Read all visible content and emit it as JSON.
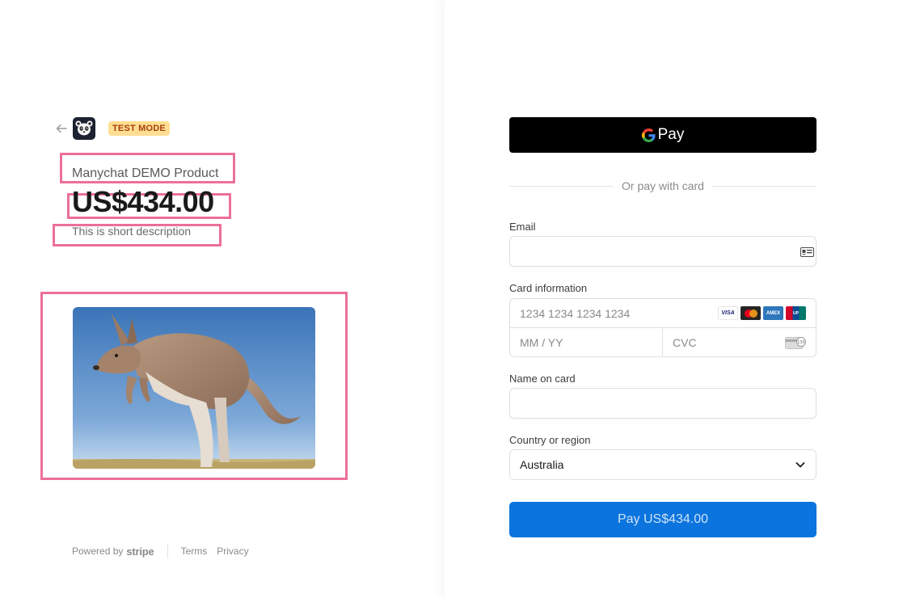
{
  "header": {
    "test_mode_badge": "TEST MODE",
    "icons": {
      "back": "arrow-left-icon",
      "logo": "panda-logo-icon"
    }
  },
  "product": {
    "name": "Manychat DEMO Product",
    "price": "US$434.00",
    "description": "This is short description",
    "image_subject": "kangaroo-photo"
  },
  "footer": {
    "powered_by": "Powered by",
    "brand": "stripe",
    "terms": "Terms",
    "privacy": "Privacy"
  },
  "payment": {
    "gpay_label": "Pay",
    "divider_text": "Or pay with card",
    "email": {
      "label": "Email",
      "value": "",
      "placeholder": ""
    },
    "card": {
      "label": "Card information",
      "number_placeholder": "1234 1234 1234 1234",
      "expiry_placeholder": "MM / YY",
      "cvc_placeholder": "CVC",
      "brands": [
        "VISA",
        "mastercard",
        "amex",
        "unionpay"
      ]
    },
    "name_on_card": {
      "label": "Name on card",
      "value": ""
    },
    "country": {
      "label": "Country or region",
      "selected": "Australia"
    },
    "submit_label": "Pay US$434.00"
  },
  "colors": {
    "pay_button": "#0b74de",
    "badge_bg": "#ffde92",
    "badge_text": "#a4410f",
    "highlight": "#ec6f9b"
  }
}
